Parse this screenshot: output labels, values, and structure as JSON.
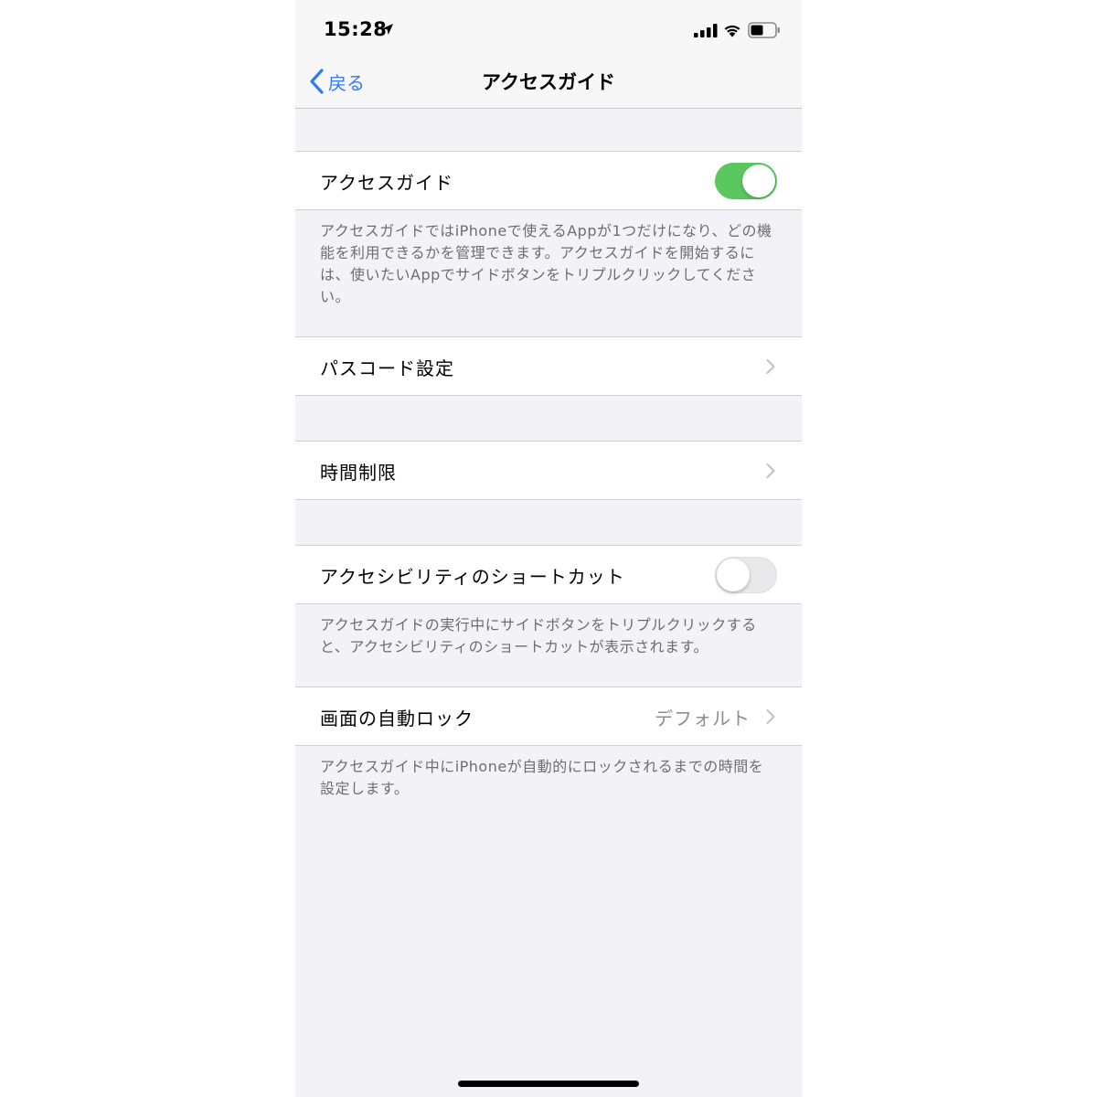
{
  "status_bar": {
    "time": "15:28",
    "icons": [
      "location-arrow-icon",
      "cellular-signal-icon",
      "wifi-icon",
      "battery-icon"
    ]
  },
  "nav": {
    "back_label": "戻る",
    "title": "アクセスガイド"
  },
  "guided_access": {
    "label": "アクセスガイド",
    "enabled": true,
    "footer": "アクセスガイドではiPhoneで使えるAppが1つだけになり、どの機能を利用できるかを管理できます。アクセスガイドを開始するには、使いたいAppでサイドボタンをトリプルクリックしてください。"
  },
  "passcode_settings": {
    "label": "パスコード設定"
  },
  "time_limits": {
    "label": "時間制限"
  },
  "accessibility_shortcut": {
    "label": "アクセシビリティのショートカット",
    "enabled": false,
    "footer": "アクセスガイドの実行中にサイドボタンをトリプルクリックすると、アクセシビリティのショートカットが表示されます。"
  },
  "auto_lock": {
    "label": "画面の自動ロック",
    "value": "デフォルト",
    "footer": "アクセスガイド中にiPhoneが自動的にロックされるまでの時間を設定します。"
  },
  "colors": {
    "accent": "#3478f6",
    "toggle_on": "#5ac85f",
    "background": "#f2f2f7"
  }
}
